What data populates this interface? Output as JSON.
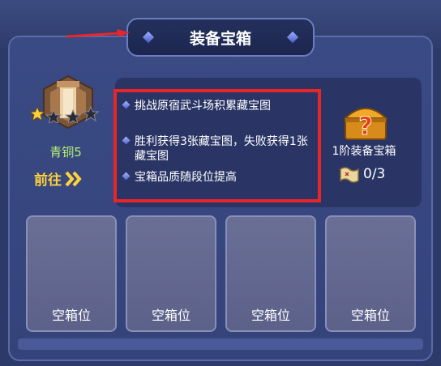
{
  "title": "装备宝箱",
  "rank": {
    "name": "青铜5",
    "stars_filled": 1,
    "stars_total": 3,
    "goto_label": "前往",
    "goto_icon": "double-chevron-right-icon"
  },
  "rules": [
    "挑战原宿武斗场积累藏宝图",
    "胜利获得3张藏宝图，失败获得1张藏宝图",
    "宝箱品质随段位提高"
  ],
  "chest": {
    "name": "1阶装备宝箱",
    "progress": "0/3",
    "icon": "treasure-chest-icon",
    "map_icon": "treasure-map-icon"
  },
  "slots": [
    "空箱位",
    "空箱位",
    "空箱位",
    "空箱位"
  ],
  "colors": {
    "highlight": "#e8262a",
    "rank_text": "#b8f070",
    "goto_text": "#ffd23a"
  }
}
